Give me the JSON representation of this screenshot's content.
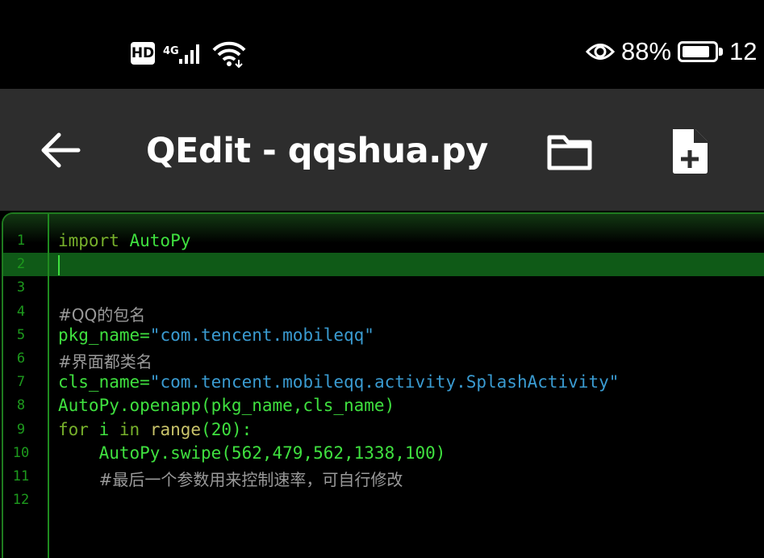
{
  "status_bar": {
    "hd_badge": "HD",
    "network_type": "4G",
    "battery_percent": "88%",
    "battery_level": 0.88,
    "clock": "12",
    "icons": [
      "hd-icon",
      "signal-icon",
      "wifi-icon",
      "eye-icon",
      "battery-icon"
    ]
  },
  "app_bar": {
    "title": "QEdit - qqshua.py",
    "back_icon": "arrow-left-icon",
    "folder_icon": "folder-icon",
    "new_file_icon": "new-file-icon"
  },
  "editor": {
    "current_line": 2,
    "lines": [
      {
        "num": "1",
        "tokens": [
          {
            "t": "import",
            "c": "kw"
          },
          {
            "t": " AutoPy",
            "c": "id"
          }
        ]
      },
      {
        "num": "2",
        "tokens": []
      },
      {
        "num": "3",
        "tokens": []
      },
      {
        "num": "4",
        "tokens": [
          {
            "t": "#QQ的包名",
            "c": "cmt"
          }
        ]
      },
      {
        "num": "5",
        "tokens": [
          {
            "t": "pkg_name=",
            "c": "id"
          },
          {
            "t": "\"com.tencent.mobileqq\"",
            "c": "str"
          }
        ]
      },
      {
        "num": "6",
        "tokens": [
          {
            "t": "#界面都类名",
            "c": "cmt"
          }
        ]
      },
      {
        "num": "7",
        "tokens": [
          {
            "t": "cls_name=",
            "c": "id"
          },
          {
            "t": "\"com.tencent.mobileqq.activity.SplashActivity\"",
            "c": "str"
          }
        ]
      },
      {
        "num": "8",
        "tokens": [
          {
            "t": "AutoPy.openapp(pkg_name,cls_name)",
            "c": "id"
          }
        ]
      },
      {
        "num": "9",
        "tokens": [
          {
            "t": "for",
            "c": "kw"
          },
          {
            "t": " i ",
            "c": "id"
          },
          {
            "t": "in",
            "c": "kw"
          },
          {
            "t": " ",
            "c": "id"
          },
          {
            "t": "range",
            "c": "fn"
          },
          {
            "t": "(20):",
            "c": "id"
          }
        ]
      },
      {
        "num": "10",
        "tokens": [
          {
            "t": "    AutoPy.swipe(562,479,562,1338,100)",
            "c": "id"
          }
        ]
      },
      {
        "num": "11",
        "tokens": [
          {
            "t": "    ",
            "c": "id"
          },
          {
            "t": "#最后一个参数用来控制速率，可自行修改",
            "c": "cmt"
          }
        ]
      },
      {
        "num": "12",
        "tokens": []
      }
    ]
  }
}
